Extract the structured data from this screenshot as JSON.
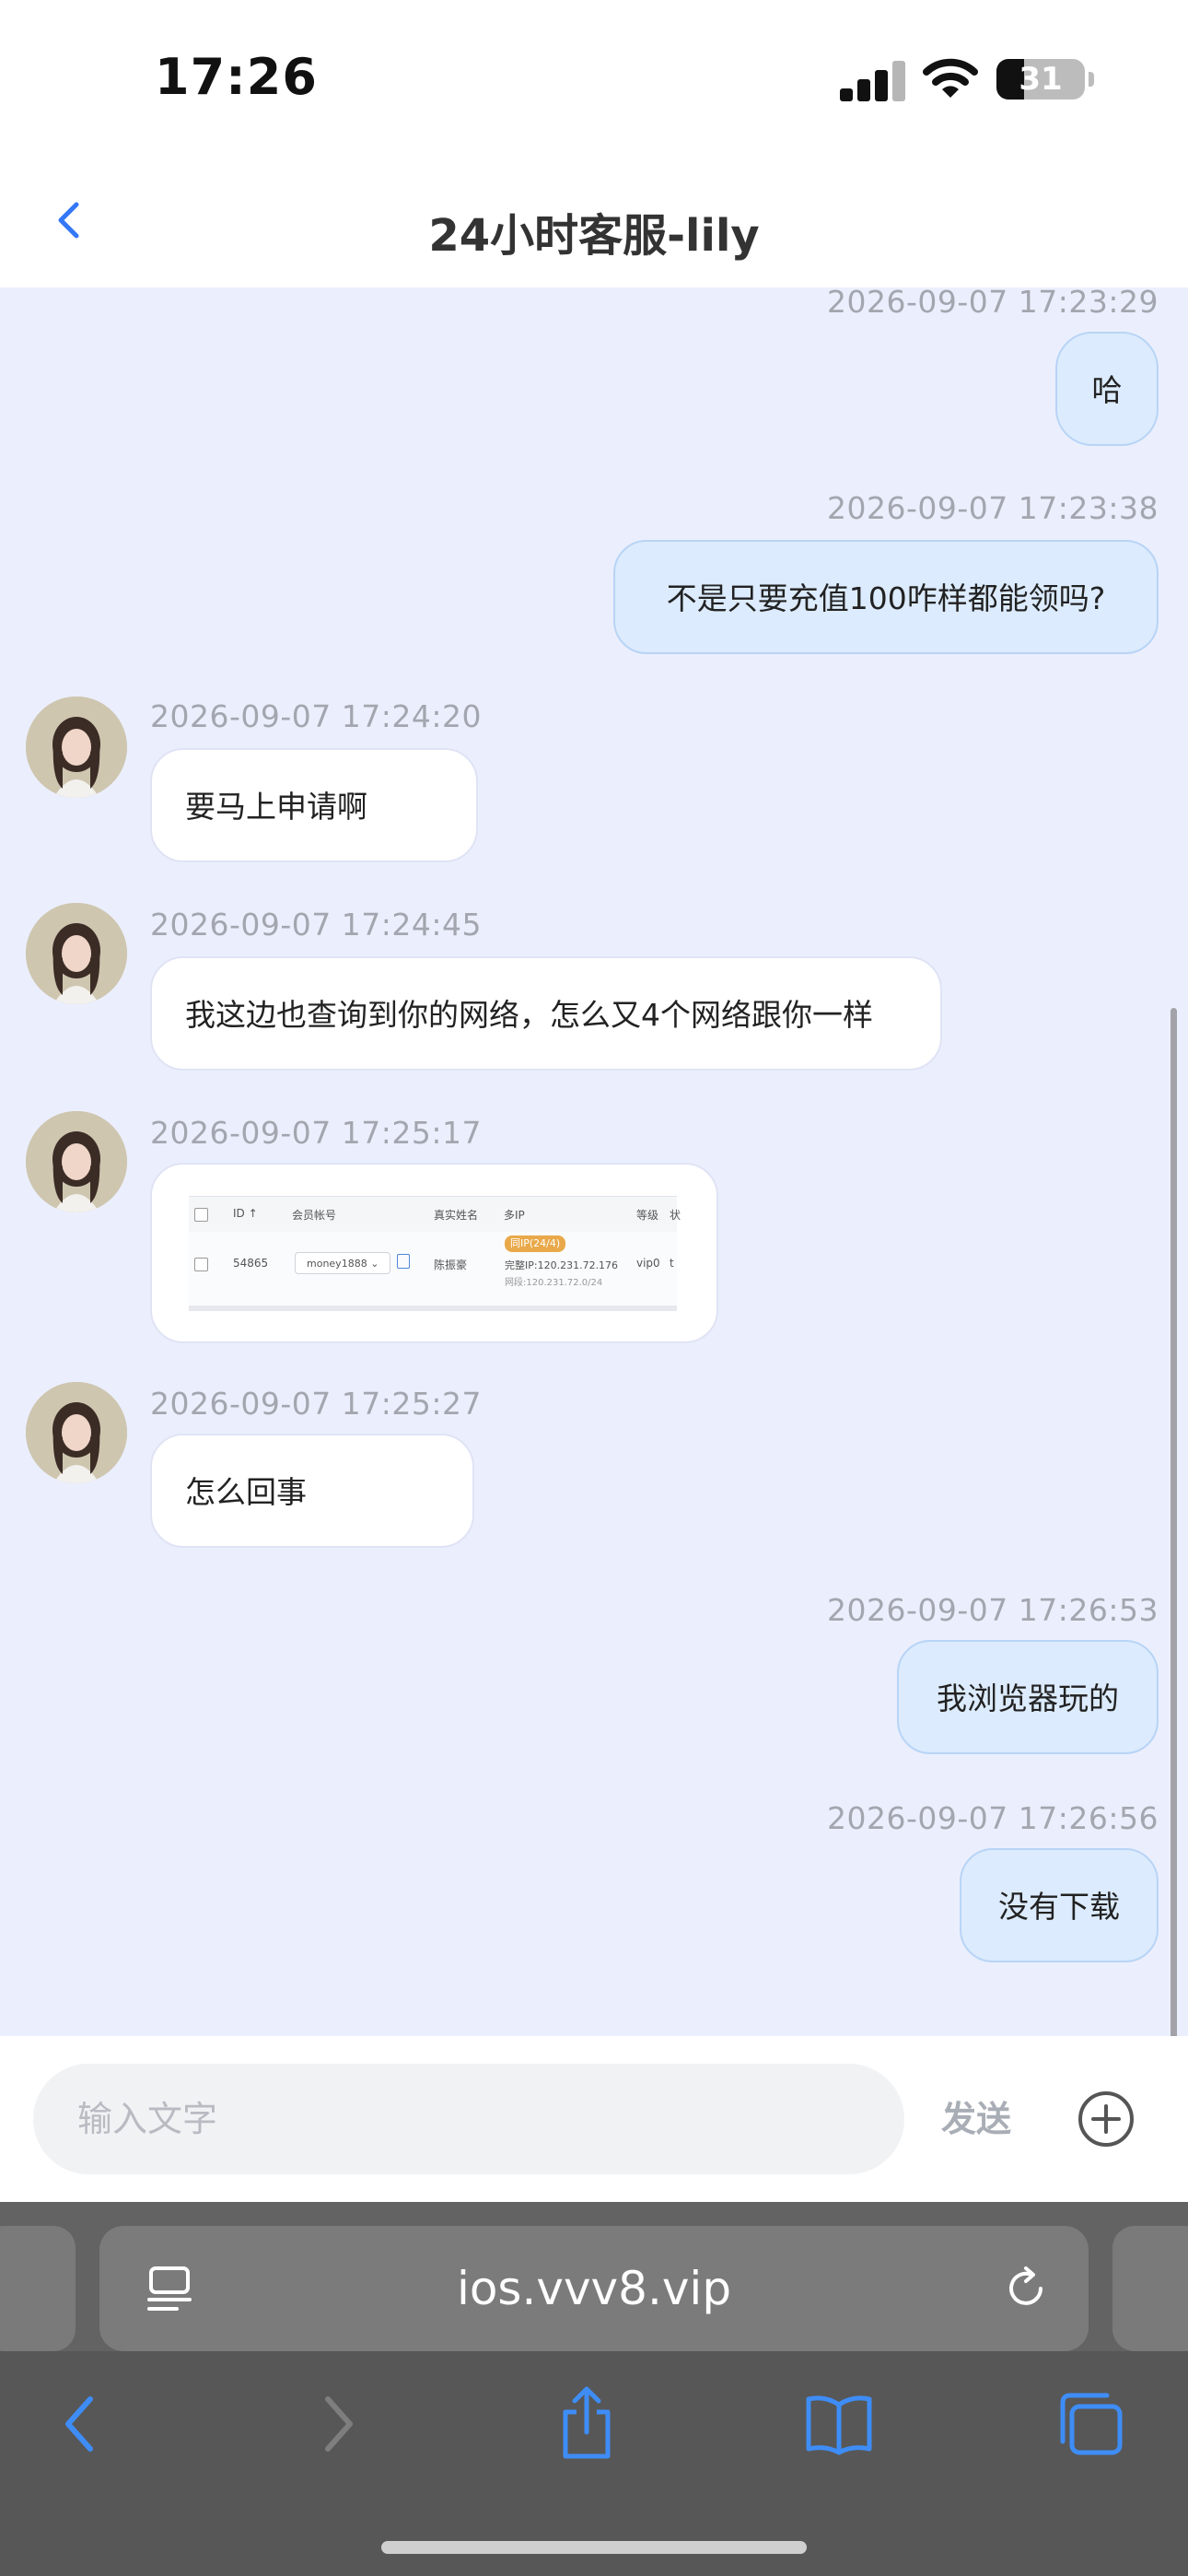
{
  "status_bar": {
    "time": "17:26",
    "battery": "31",
    "battery_level": 0.31
  },
  "header": {
    "title": "24小时客服-lily"
  },
  "messages": [
    {
      "side": "out",
      "time": "2026-09-07 17:23:29",
      "text": "哈"
    },
    {
      "side": "out",
      "time": "2026-09-07 17:23:38",
      "text": "不是只要充值100咋样都能领吗?"
    },
    {
      "side": "in",
      "time": "2026-09-07 17:24:20",
      "text": "要马上申请啊"
    },
    {
      "side": "in",
      "time": "2026-09-07 17:24:45",
      "text": "我这边也查询到你的网络，怎么又4个网络跟你一样"
    },
    {
      "side": "in",
      "time": "2026-09-07 17:25:17",
      "type": "image"
    },
    {
      "side": "in",
      "time": "2026-09-07 17:25:27",
      "text": "怎么回事"
    },
    {
      "side": "out",
      "time": "2026-09-07 17:26:53",
      "text": "我浏览器玩的"
    },
    {
      "side": "out",
      "time": "2026-09-07 17:26:56",
      "text": "没有下载"
    }
  ],
  "screenshot_table": {
    "headers": [
      "ID ↑",
      "会员帐号",
      "真实姓名",
      "多IP",
      "等级",
      "状"
    ],
    "row": {
      "id": "54865",
      "account": "money1888",
      "name": "陈振豪",
      "ip_badge": "同IP(24/4)",
      "ip_line1": "完整IP:120.231.72.176",
      "ip_line2": "网段:120.231.72.0/24",
      "level": "vip0",
      "extra": "t"
    }
  },
  "input": {
    "placeholder": "输入文字",
    "send_label": "发送"
  },
  "browser": {
    "url": "ios.vvv8.vip"
  },
  "icons": {
    "back": "chevron-left-icon",
    "plus": "plus-circle-icon",
    "reader": "reader-icon",
    "reload": "reload-icon",
    "share": "share-icon",
    "bookmarks": "book-icon",
    "tabs": "tabs-icon"
  },
  "colors": {
    "accent": "#3478f6",
    "chat_bg": "#ebeffd",
    "outgoing_bubble": "#dcebfd"
  }
}
